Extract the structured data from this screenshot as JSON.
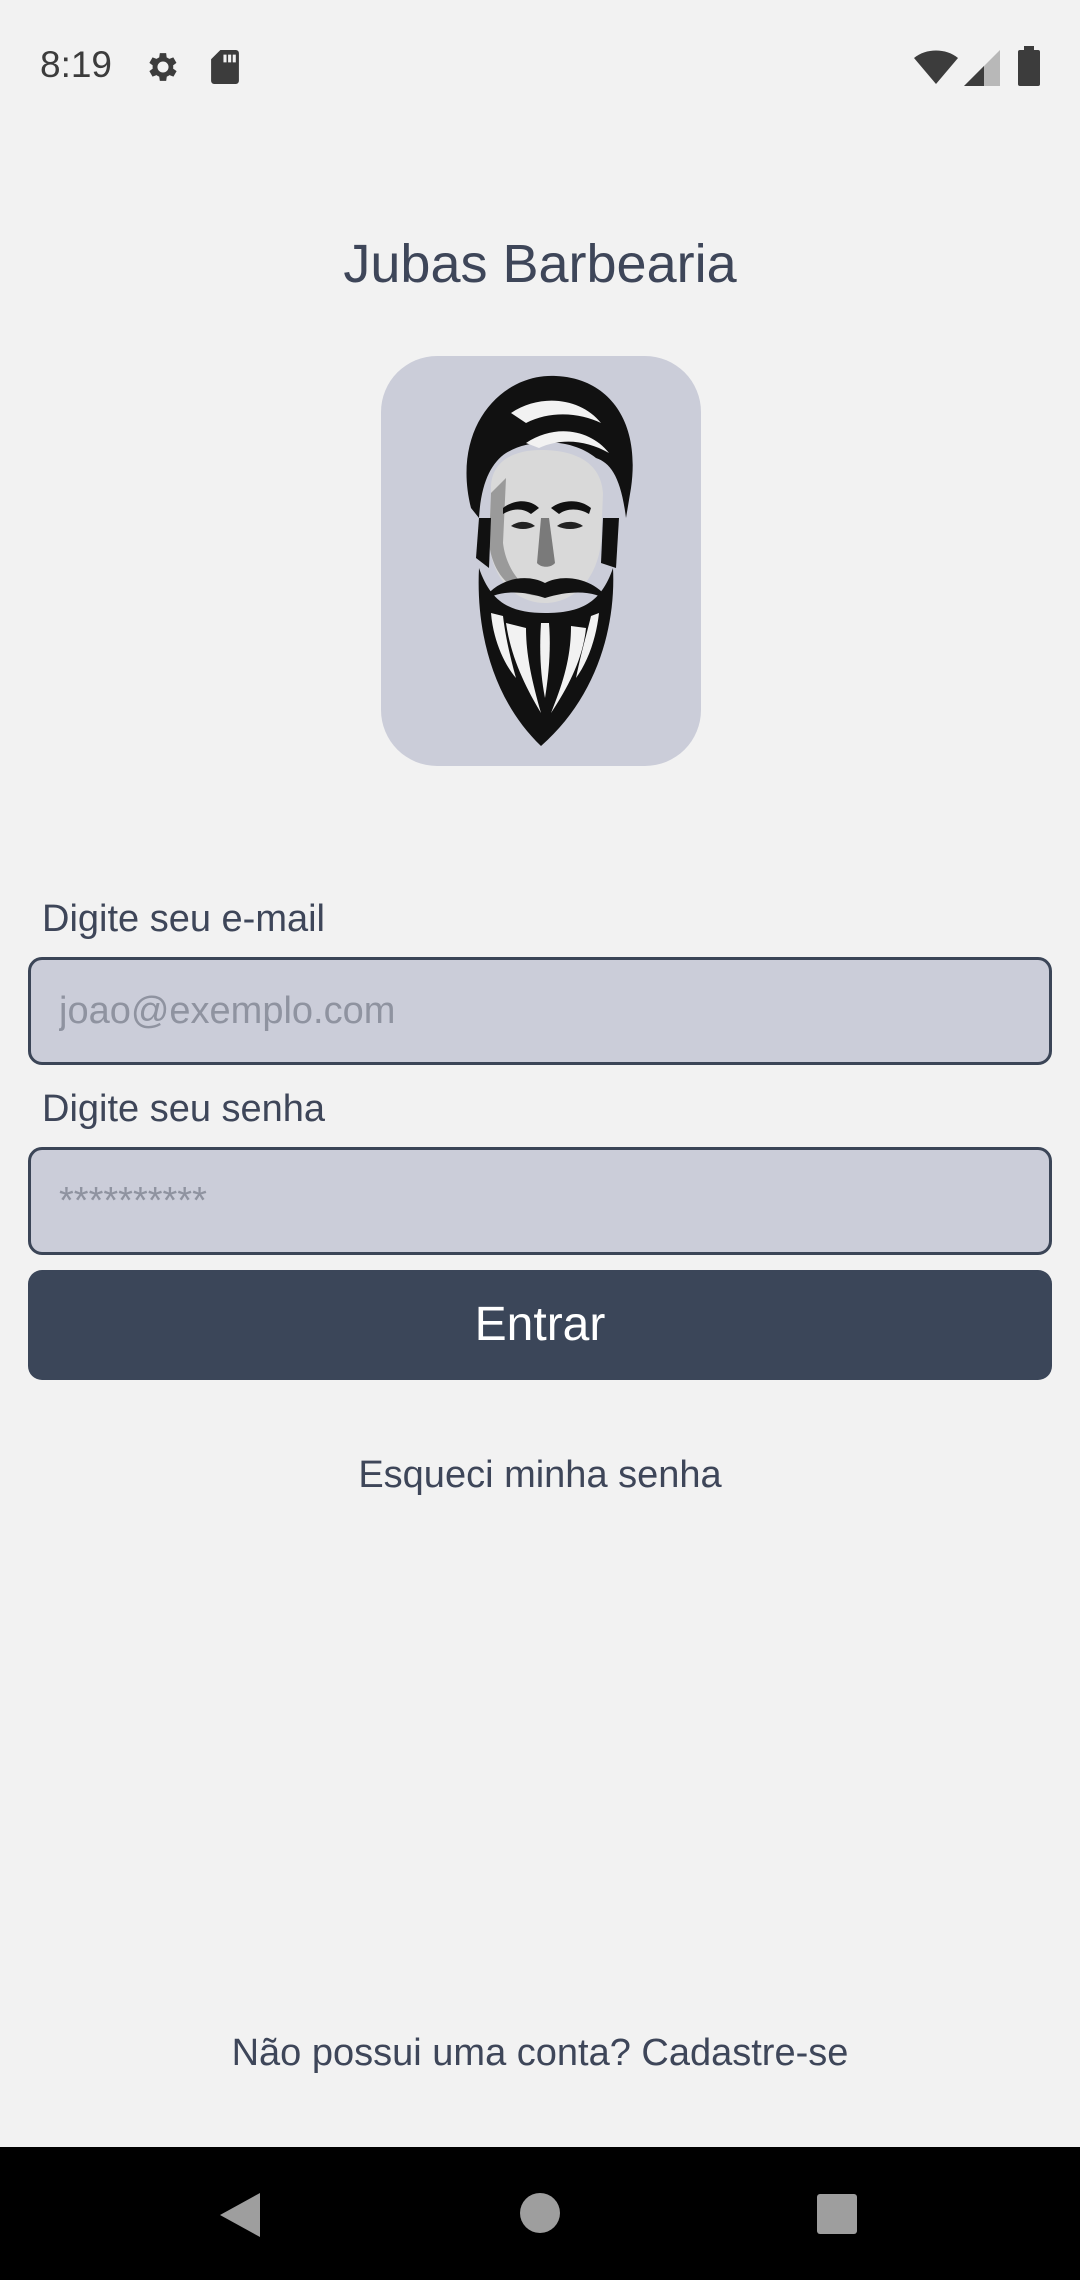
{
  "status_bar": {
    "time": "8:19",
    "icons": [
      "gear-icon",
      "sd-card-icon",
      "wifi-icon",
      "signal-icon",
      "battery-icon"
    ]
  },
  "app": {
    "title": "Jubas Barbearia",
    "logo": "bearded-man-logo"
  },
  "form": {
    "email_label": "Digite seu e-mail",
    "email_placeholder": "joao@exemplo.com",
    "email_value": "",
    "password_label": "Digite seu senha",
    "password_placeholder": "**********",
    "password_value": "",
    "submit_label": "Entrar"
  },
  "links": {
    "forgot_password": "Esqueci minha senha",
    "signup": "Não possui uma conta? Cadastre-se"
  },
  "nav_bar": {
    "icons": [
      "back-icon",
      "home-icon",
      "recents-icon"
    ]
  },
  "colors": {
    "background": "#f2f2f2",
    "primary": "#3b4659",
    "field_background": "#cbcdd9",
    "text": "#3e4659",
    "placeholder": "#8f93a0"
  }
}
